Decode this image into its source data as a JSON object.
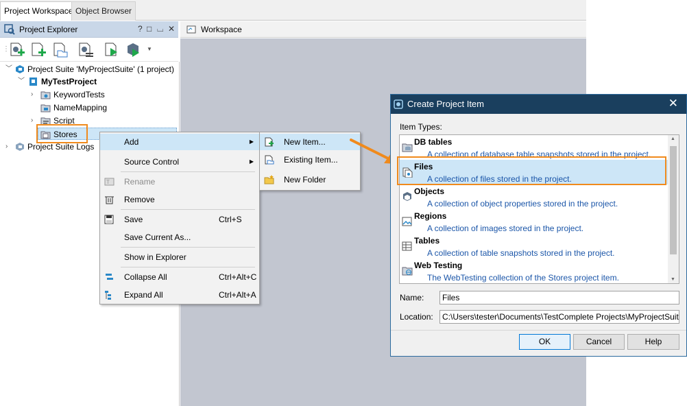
{
  "tabs": [
    "Project Workspace",
    "Object Browser"
  ],
  "project_explorer": {
    "title": "Project Explorer",
    "controls": [
      "?",
      "□",
      "⌴",
      "✕"
    ],
    "toolbar_icons": [
      "add-project-icon",
      "add-item-icon",
      "open-folder-icon",
      "properties-icon",
      "run-icon",
      "run-options-icon",
      "dropdown-icon"
    ],
    "tree": [
      {
        "label": "Project Suite 'MyProjectSuite' (1 project)",
        "icon": "suite-icon"
      },
      {
        "label": "MyTestProject",
        "icon": "project-icon"
      },
      {
        "label": "KeywordTests",
        "icon": "keyword-tests-icon"
      },
      {
        "label": "NameMapping",
        "icon": "name-mapping-icon"
      },
      {
        "label": "Script",
        "icon": "script-icon"
      },
      {
        "label": "Stores",
        "icon": "stores-icon"
      },
      {
        "label": "Project Suite Logs",
        "icon": "logs-icon"
      }
    ]
  },
  "workspace": {
    "title": "Workspace"
  },
  "context_menu": {
    "items": [
      {
        "label": "Add",
        "shortcut": ""
      },
      {
        "label": "Source Control",
        "shortcut": ""
      },
      {
        "label": "Rename",
        "shortcut": ""
      },
      {
        "label": "Remove",
        "shortcut": ""
      },
      {
        "label": "Save",
        "shortcut": "Ctrl+S"
      },
      {
        "label": "Save Current As...",
        "shortcut": ""
      },
      {
        "label": "Show in Explorer",
        "shortcut": ""
      },
      {
        "label": "Collapse All",
        "shortcut": "Ctrl+Alt+C"
      },
      {
        "label": "Expand All",
        "shortcut": "Ctrl+Alt+A"
      }
    ]
  },
  "add_submenu": {
    "items": [
      {
        "label": "New Item..."
      },
      {
        "label": "Existing Item..."
      },
      {
        "label": "New Folder"
      }
    ]
  },
  "dialog": {
    "title": "Create Project Item",
    "item_types_label": "Item Types:",
    "items": [
      {
        "name": "DB tables",
        "desc": "A collection of database table snapshots stored in the project."
      },
      {
        "name": "Files",
        "desc": "A collection of files stored in the project."
      },
      {
        "name": "Objects",
        "desc": "A collection of object properties stored in the project."
      },
      {
        "name": "Regions",
        "desc": "A collection of images stored in the project."
      },
      {
        "name": "Tables",
        "desc": "A collection of table snapshots stored in the project."
      },
      {
        "name": "Web Testing",
        "desc": "The WebTesting collection of the Stores project item."
      }
    ],
    "name_label": "Name:",
    "name_value": "Files",
    "location_label": "Location:",
    "location_value": "C:\\Users\\tester\\Documents\\TestComplete Projects\\MyProjectSuite\\T ...",
    "ok": "OK",
    "cancel": "Cancel",
    "help": "Help"
  },
  "colors": {
    "highlight": "#f08a1c",
    "title_bar": "#1a3f5e",
    "selection": "#cde6f7",
    "link_blue": "#1a55a8"
  }
}
